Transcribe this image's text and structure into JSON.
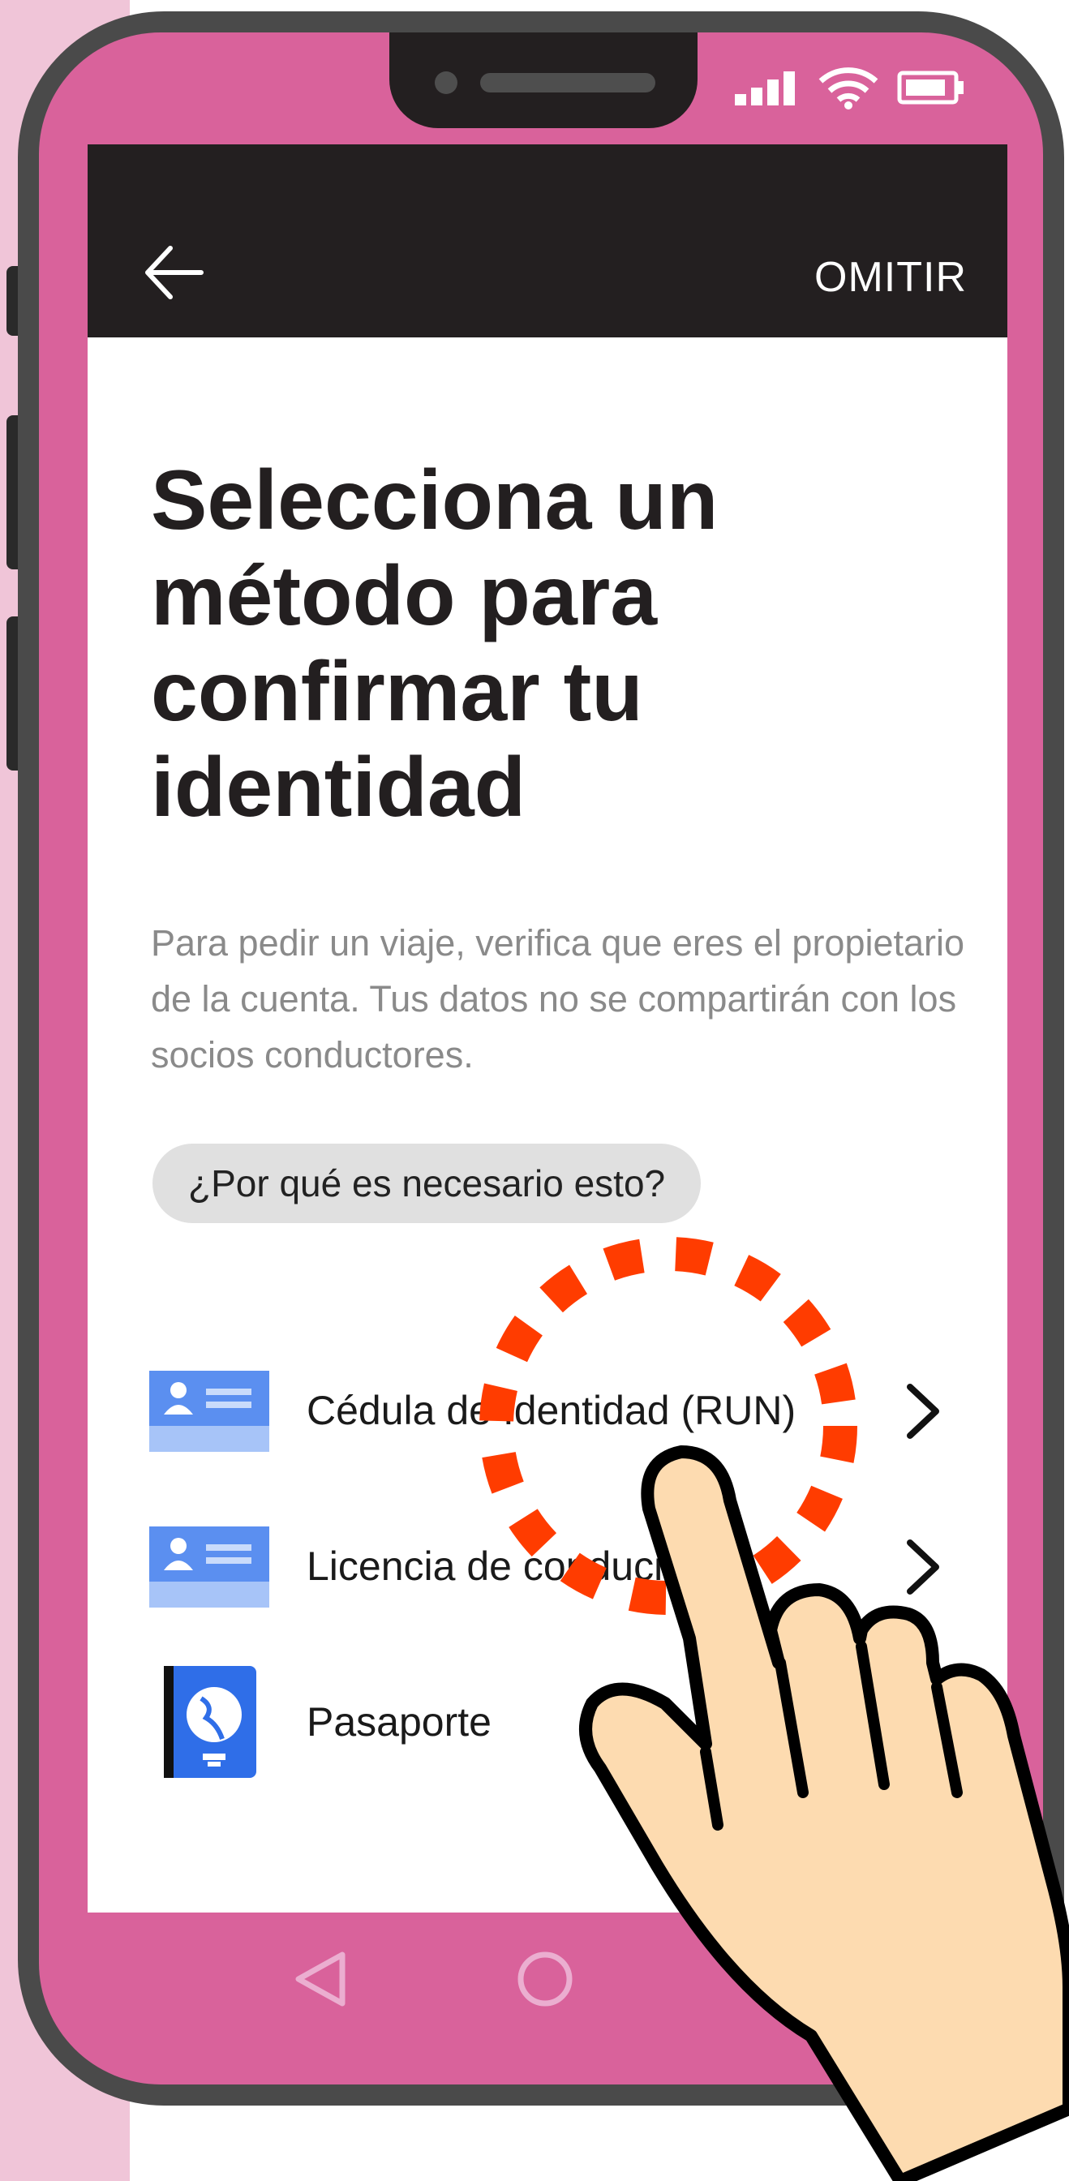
{
  "topbar": {
    "skip_label": "OMITIR"
  },
  "content": {
    "title": "Selecciona un método para confirmar tu identidad",
    "description": "Para pedir un viaje, verifica que eres el propietario de la cuenta. Tus datos no se compartirán con los socios conductores.",
    "why_button": "¿Por qué es necesario esto?"
  },
  "methods": [
    {
      "label": "Cédula de Identidad (RUN)",
      "icon": "id-card-icon"
    },
    {
      "label": "Licencia de conducir",
      "icon": "id-card-icon"
    },
    {
      "label": "Pasaporte",
      "icon": "passport-icon"
    }
  ],
  "colors": {
    "phone_pink": "#d9629b",
    "appbar": "#231f20",
    "highlight": "#ff3c00",
    "card_blue": "#5b8ff0",
    "passport_blue": "#2f6ee8",
    "hand_skin": "#fddbb0"
  }
}
